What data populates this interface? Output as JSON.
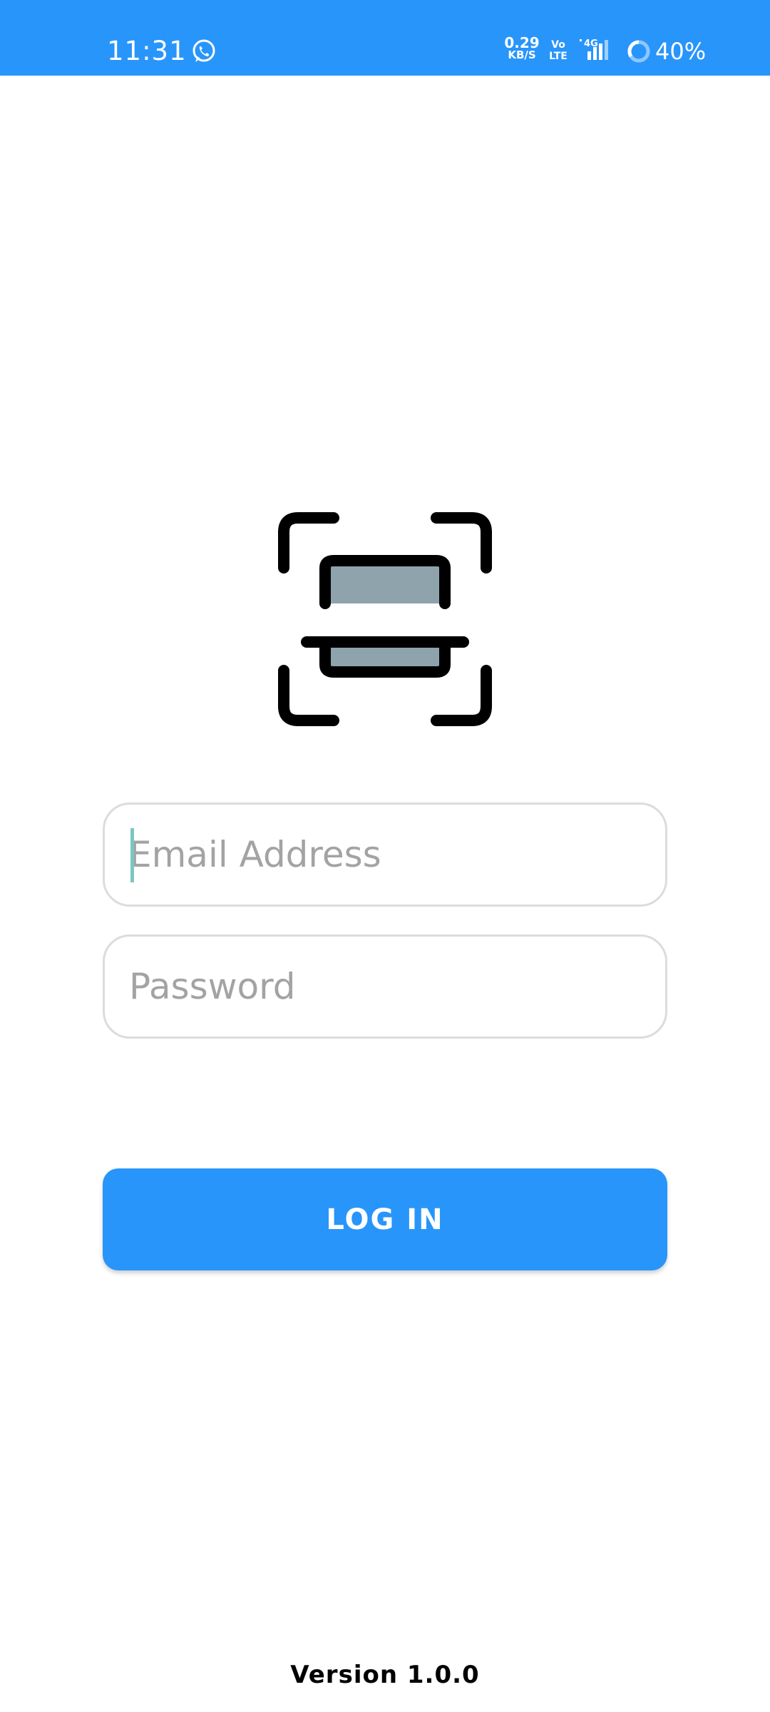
{
  "status_bar": {
    "time": "11:31",
    "net_speed_value": "0.29",
    "net_speed_unit": "KB/S",
    "volte_line1": "Vo",
    "volte_line2": "LTE",
    "network_type": "4G",
    "battery_percent": "40%",
    "background_color": "#2895fb",
    "icons": [
      "whatsapp-icon",
      "signal-icon",
      "battery-ring-icon"
    ]
  },
  "logo": {
    "icon": "document-scan-icon",
    "bracket_color": "#000000",
    "fill_color": "#8fa3ad"
  },
  "form": {
    "email": {
      "placeholder": "Email Address",
      "value": ""
    },
    "password": {
      "placeholder": "Password",
      "value": ""
    },
    "login_label": "LOG IN",
    "button_color": "#2895fb"
  },
  "footer": {
    "version": "Version 1.0.0"
  }
}
